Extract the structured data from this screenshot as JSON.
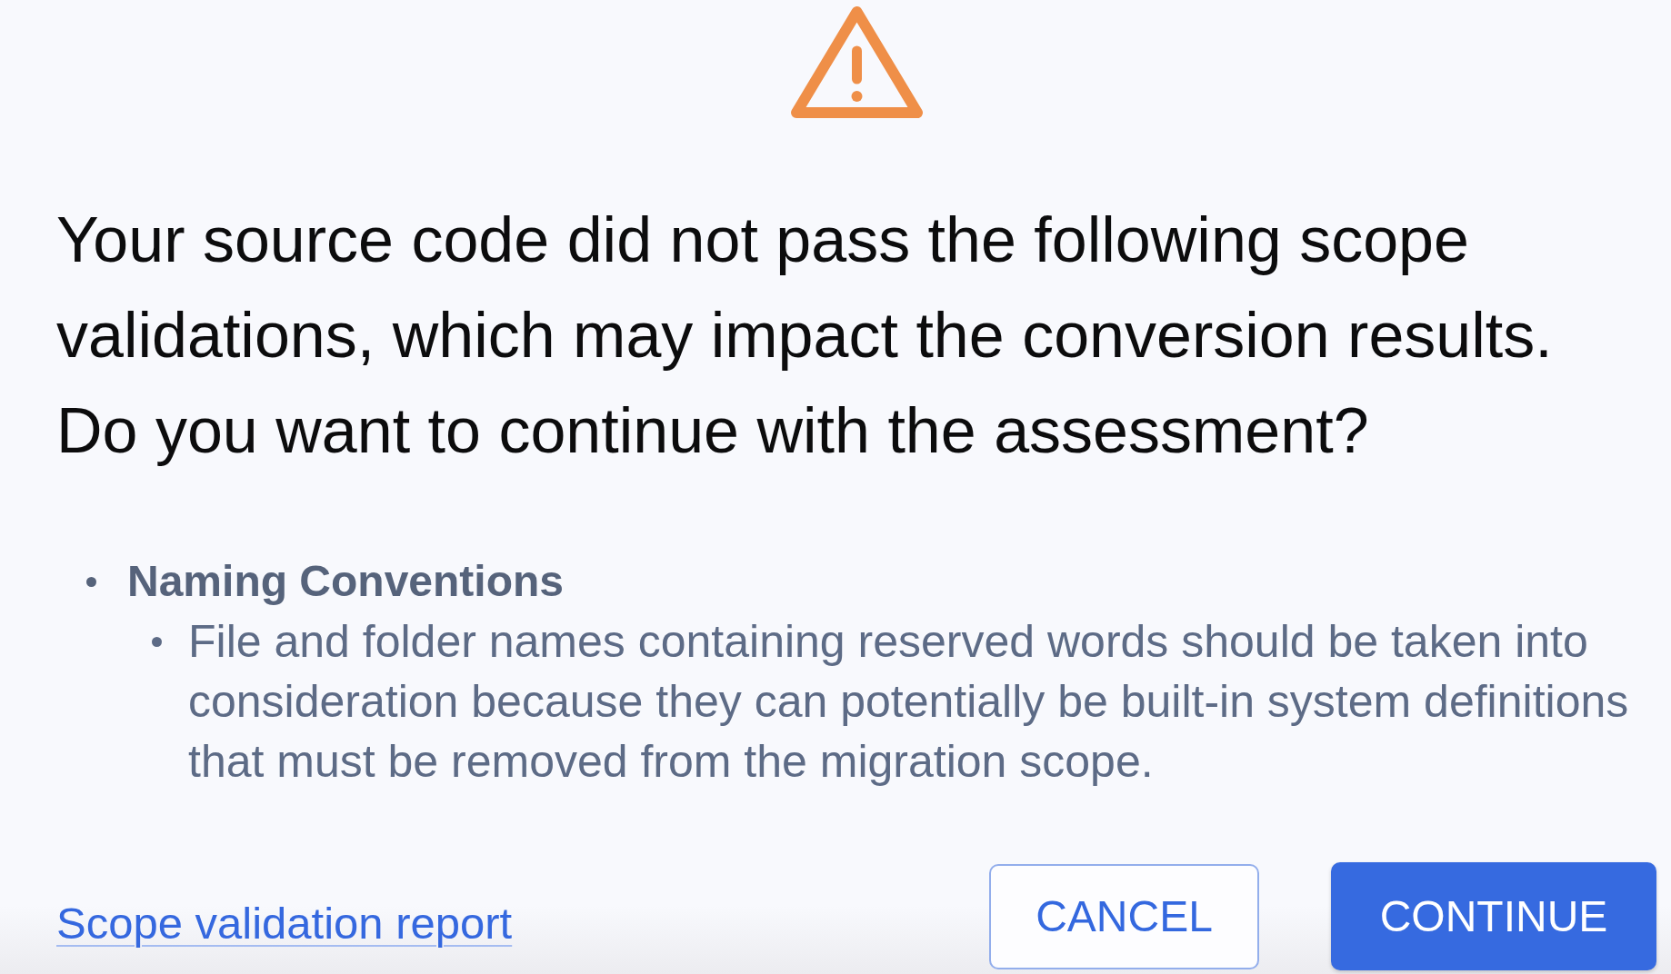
{
  "dialog": {
    "message": "Your source code did not pass the following scope validations, which may impact the conversion results.",
    "question": "Do you want to continue with the assessment?",
    "validations": [
      {
        "title": "Naming Conventions",
        "children": [
          {
            "text": "File and folder names containing reserved words should be taken into consideration because they can potentially be built-in system definitions that must be removed from the migration scope."
          }
        ]
      }
    ],
    "link": "Scope validation report",
    "buttons": [
      {
        "label": "CANCEL",
        "kind": "secondary"
      },
      {
        "label": "CONTINUE",
        "kind": "primary"
      }
    ]
  }
}
